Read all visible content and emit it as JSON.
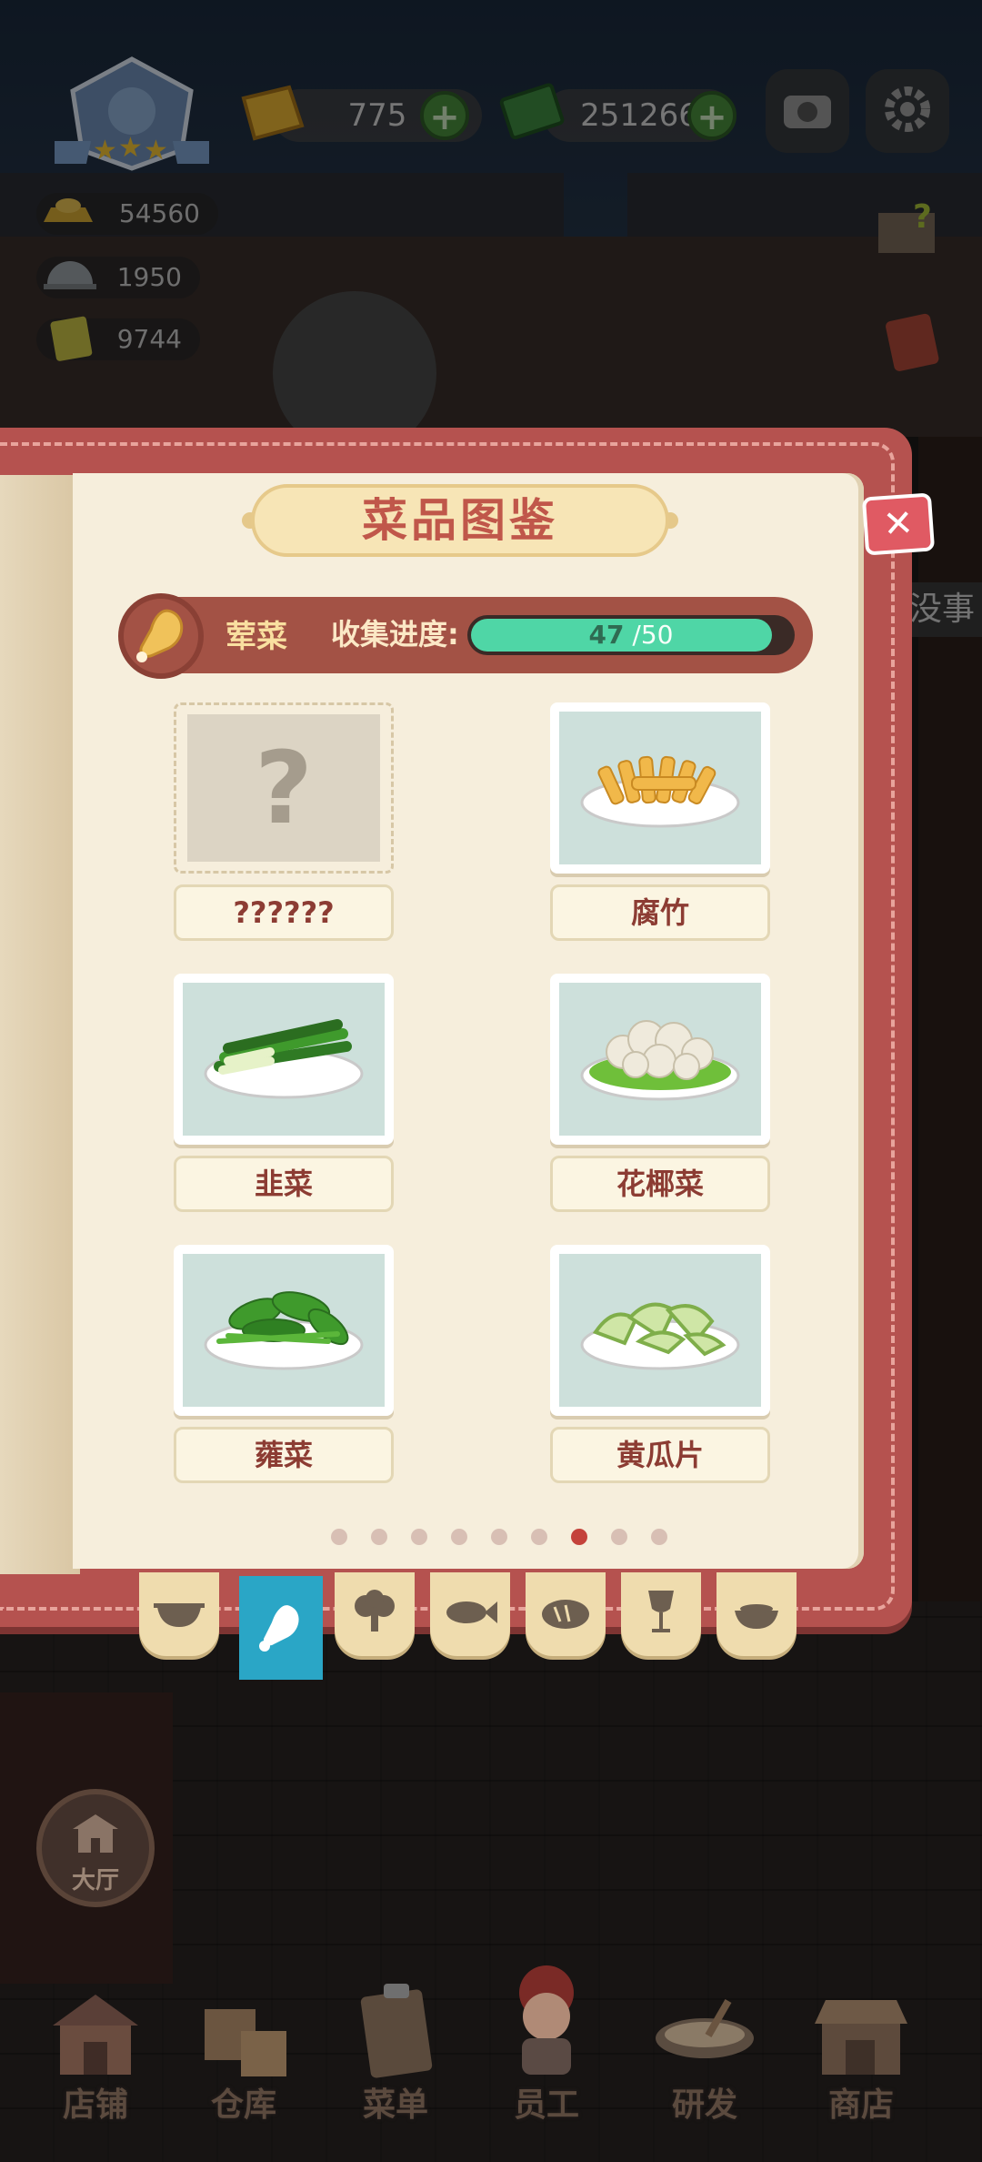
{
  "hud": {
    "gems": "775",
    "cash": "251266",
    "plus_symbol": "+",
    "stats": [
      "54560",
      "1950",
      "9744"
    ],
    "player_stars": 3
  },
  "book": {
    "title": "菜品图鉴",
    "close_symbol": "✕",
    "category_name": "荤菜",
    "progress_label": "收集进度:",
    "progress_current": "47",
    "progress_total": "/50",
    "progress_fraction": 0.94,
    "dishes": [
      {
        "name": "??????",
        "locked": true
      },
      {
        "name": "腐竹",
        "locked": false
      },
      {
        "name": "韭菜",
        "locked": false
      },
      {
        "name": "花椰菜",
        "locked": false
      },
      {
        "name": "蕹菜",
        "locked": false
      },
      {
        "name": "黄瓜片",
        "locked": false
      }
    ],
    "locked_mark": "?",
    "page_count": 9,
    "active_page": 7,
    "tabs": [
      "wok-icon",
      "drumstick-icon",
      "broccoli-icon",
      "fish-icon",
      "bread-icon",
      "wine-glass-icon",
      "soup-bowl-icon"
    ],
    "active_tab": 1
  },
  "nav": {
    "hall": "大厅",
    "items": [
      "店铺",
      "仓库",
      "菜单",
      "员工",
      "研发",
      "商店"
    ]
  },
  "colors": {
    "book_cover": "#b5524f",
    "page": "#f6eedc",
    "progress": "#4fd6a6",
    "active_tab": "#2aa6c6",
    "title_text": "#c0574a"
  }
}
